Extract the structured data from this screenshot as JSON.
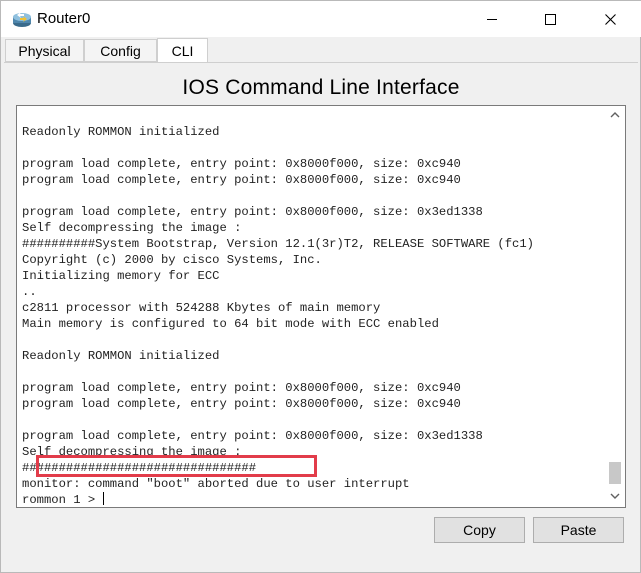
{
  "window": {
    "title": "Router0",
    "app_icon": "router-icon",
    "controls": [
      "minimize-icon",
      "maximize-icon",
      "close-icon"
    ]
  },
  "tabs": [
    {
      "label": "Physical",
      "active": false
    },
    {
      "label": "Config",
      "active": false
    },
    {
      "label": "CLI",
      "active": true
    }
  ],
  "cli": {
    "heading": "IOS Command Line Interface",
    "output": "Readonly ROMMON initialized\n\nprogram load complete, entry point: 0x8000f000, size: 0xc940\nprogram load complete, entry point: 0x8000f000, size: 0xc940\n\nprogram load complete, entry point: 0x8000f000, size: 0x3ed1338\nSelf decompressing the image :\n##########System Bootstrap, Version 12.1(3r)T2, RELEASE SOFTWARE (fc1)\nCopyright (c) 2000 by cisco Systems, Inc.\nInitializing memory for ECC\n..\nc2811 processor with 524288 Kbytes of main memory\nMain memory is configured to 64 bit mode with ECC enabled\n\nReadonly ROMMON initialized\n\nprogram load complete, entry point: 0x8000f000, size: 0xc940\nprogram load complete, entry point: 0x8000f000, size: 0xc940\n\nprogram load complete, entry point: 0x8000f000, size: 0x3ed1338\nSelf decompressing the image :\n################################\nmonitor: command \"boot\" aborted due to user interrupt\n",
    "prompt": "rommon 1 > "
  },
  "buttons": {
    "copy": "Copy",
    "paste": "Paste"
  },
  "colors": {
    "highlight": "#e23c4a"
  }
}
